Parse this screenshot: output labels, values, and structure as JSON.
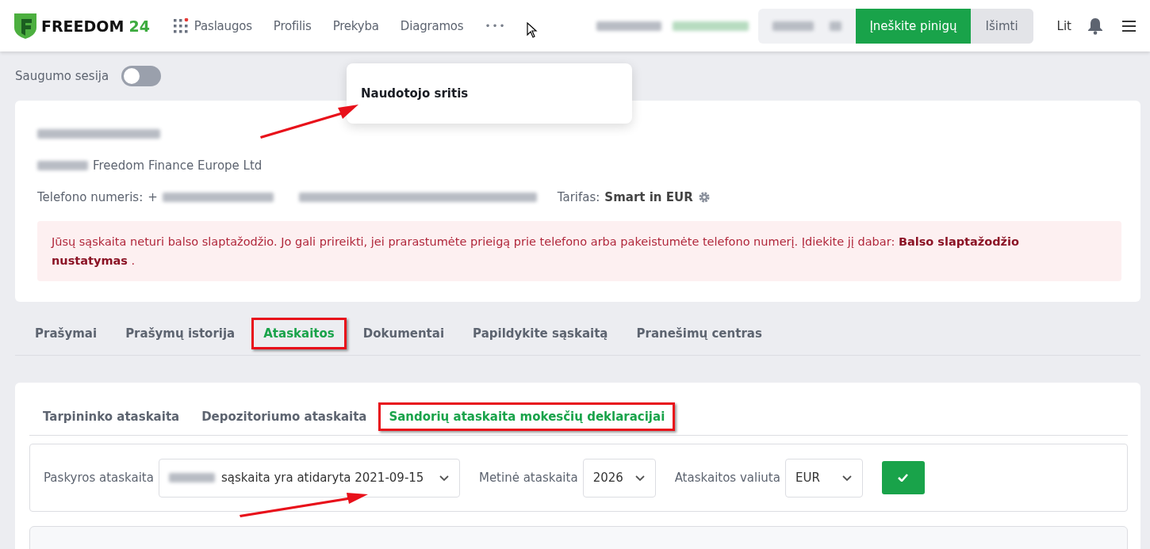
{
  "header": {
    "logo": {
      "word": "FREEDOM",
      "number": "24"
    },
    "nav": [
      {
        "label": "Paslaugos",
        "kind": "apps"
      },
      {
        "label": "Profilis",
        "kind": "link"
      },
      {
        "label": "Prekyba",
        "kind": "link"
      },
      {
        "label": "Diagramos",
        "kind": "link"
      },
      {
        "label": "•••",
        "kind": "more"
      }
    ],
    "deposit_button": "Įneškite pinigų",
    "withdraw_button": "Išimti",
    "language": {
      "label": "Lit",
      "selected": true
    }
  },
  "security_session": {
    "label": "Saugumo sesija",
    "on": false
  },
  "popover": {
    "title": "Naudotojo sritis"
  },
  "profile": {
    "company": "Freedom Finance Europe Ltd",
    "phone_label": "Telefono numeris:",
    "phone_prefix": "+",
    "tariff_label": "Tarifas:",
    "tariff": "Smart in EUR",
    "alert": "Jūsų sąskaita neturi balso slaptažodžio. Jo gali prireikti, jei prarastumėte prieigą prie telefono arba pakeistumėte telefono numerį. Įdiekite jį dabar: **Balso slaptažodžio nustatymas** ."
  },
  "tabs": [
    {
      "label": "Prašymai",
      "selected": false,
      "highlighted": false
    },
    {
      "label": "Prašymų istorija",
      "selected": false,
      "highlighted": false
    },
    {
      "label": "Ataskaitos",
      "selected": true,
      "highlighted": true
    },
    {
      "label": "Dokumentai",
      "selected": false,
      "highlighted": false
    },
    {
      "label": "Papildykite sąskaitą",
      "selected": false,
      "highlighted": false
    },
    {
      "label": "Pranešimų centras",
      "selected": false,
      "highlighted": false
    }
  ],
  "subtabs": [
    {
      "label": "Tarpininko ataskaita",
      "selected": false,
      "highlighted": false
    },
    {
      "label": "Depozitoriumo ataskaita",
      "selected": false,
      "highlighted": false
    },
    {
      "label": "Sandorių ataskaita mokesčių deklaracijai",
      "selected": true,
      "highlighted": true
    }
  ],
  "form": {
    "account_label": "Paskyros ataskaita",
    "account_value": "sąskaita yra atidaryta 2021-09-15",
    "year_label": "Metinė ataskaita",
    "year_value": "2026",
    "currency_label": "Ataskaitos valiuta",
    "currency_value": "EUR"
  }
}
